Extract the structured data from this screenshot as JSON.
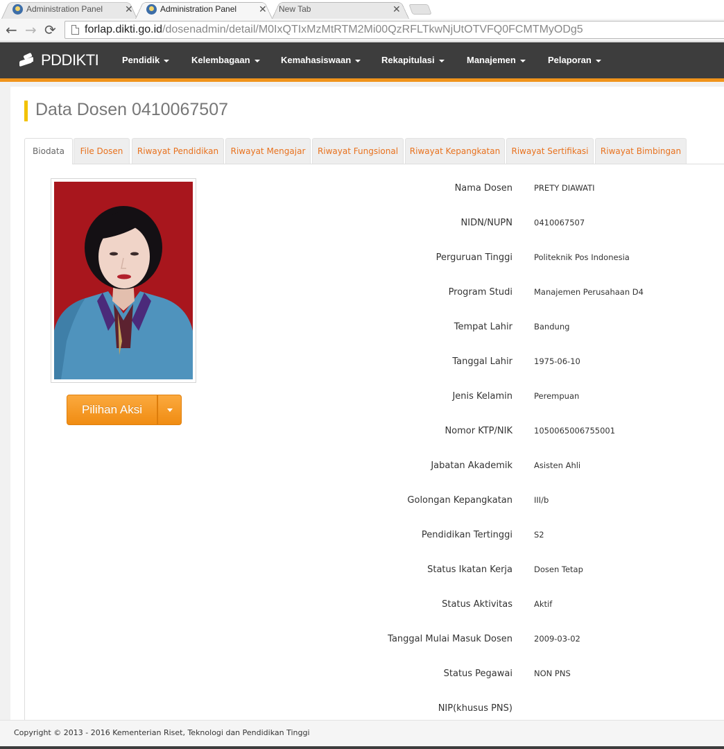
{
  "browser": {
    "tabs": [
      {
        "title": "Administration Panel",
        "active": false
      },
      {
        "title": "Administration Panel",
        "active": true
      },
      {
        "title": "New Tab",
        "active": false
      }
    ],
    "url_host": "forlap.dikti.go.id",
    "url_path": "/dosenadmin/detail/M0IxQTIxMzMtRTM2Mi00QzRFLTkwNjUtOTVFQ0FCMTMyODg5",
    "close_glyph": "✕",
    "back_glyph": "←",
    "forward_glyph": "→",
    "reload_glyph": "⟳"
  },
  "navbar": {
    "brand": "PDDIKTI",
    "menus": [
      "Pendidik",
      "Kelembagaan",
      "Kemahasiswaan",
      "Rekapitulasi",
      "Manajemen",
      "Pelaporan"
    ]
  },
  "page": {
    "title": "Data Dosen 0410067507",
    "tabs": [
      "Biodata",
      "File Dosen",
      "Riwayat Pendidikan",
      "Riwayat Mengajar",
      "Riwayat Fungsional",
      "Riwayat Kepangkatan",
      "Riwayat Sertifikasi",
      "Riwayat Bimbingan"
    ],
    "active_tab": "Biodata",
    "action_button": "Pilihan Aksi"
  },
  "biodata": [
    {
      "label": "Nama Dosen",
      "value": "PRETY DIAWATI"
    },
    {
      "label": "NIDN/NUPN",
      "value": "0410067507"
    },
    {
      "label": "Perguruan Tinggi",
      "value": "Politeknik Pos Indonesia"
    },
    {
      "label": "Program Studi",
      "value": "Manajemen Perusahaan D4"
    },
    {
      "label": "Tempat Lahir",
      "value": "Bandung"
    },
    {
      "label": "Tanggal Lahir",
      "value": "1975-06-10"
    },
    {
      "label": "Jenis Kelamin",
      "value": "Perempuan"
    },
    {
      "label": "Nomor KTP/NIK",
      "value": "1050065006755001"
    },
    {
      "label": "Jabatan Akademik",
      "value": "Asisten Ahli"
    },
    {
      "label": "Golongan Kepangkatan",
      "value": "III/b"
    },
    {
      "label": "Pendidikan Tertinggi",
      "value": "S2"
    },
    {
      "label": "Status Ikatan Kerja",
      "value": "Dosen Tetap"
    },
    {
      "label": "Status Aktivitas",
      "value": "Aktif"
    },
    {
      "label": "Tanggal Mulai Masuk Dosen",
      "value": "2009-03-02"
    },
    {
      "label": "Status Pegawai",
      "value": "NON PNS"
    },
    {
      "label": "NIP(khusus PNS)",
      "value": ""
    }
  ],
  "footer": {
    "copyright": "Copyright © 2013 - 2016 Kementerian Riset, Teknologi dan Pendidikan Tinggi"
  },
  "colors": {
    "navbar": "#3d3d3d",
    "accent": "#f0931b",
    "tab_link": "#e8711d",
    "title_bar": "#f2c200",
    "photo_bg": "#a8161d"
  }
}
